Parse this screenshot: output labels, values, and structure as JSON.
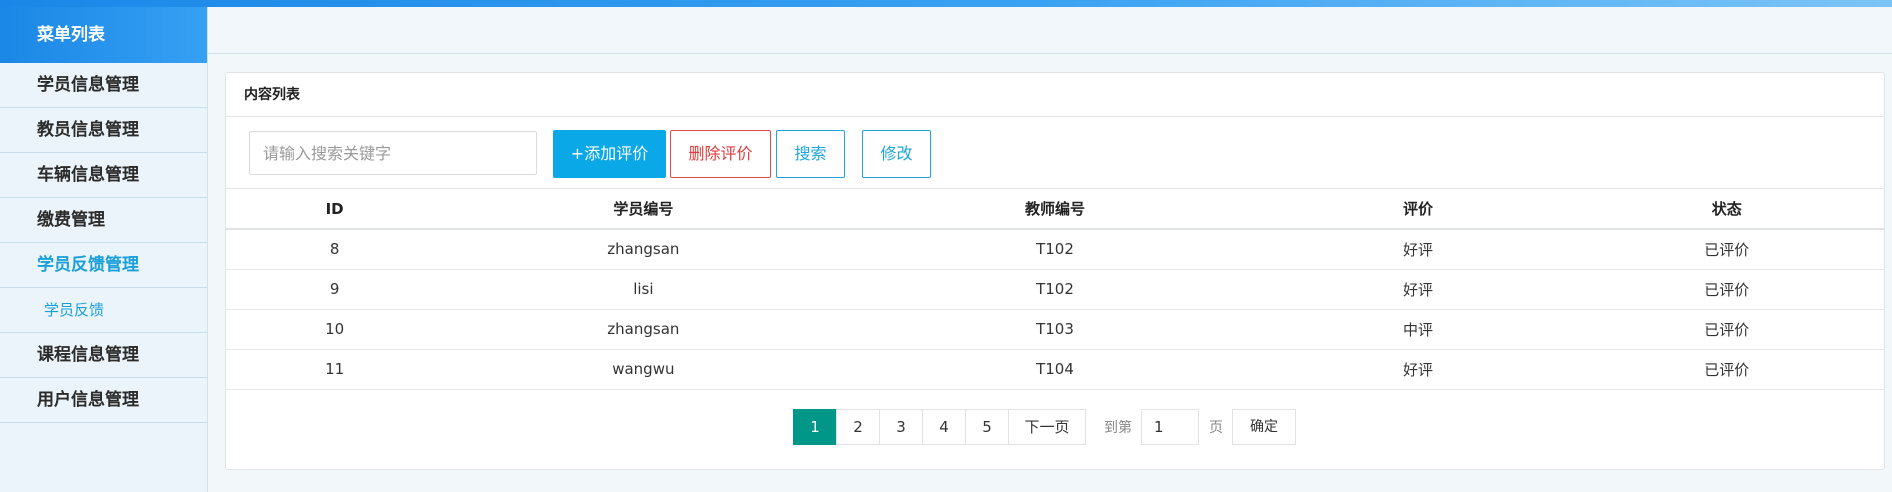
{
  "sidebar": {
    "title": "菜单列表",
    "items": [
      {
        "label": "学员信息管理"
      },
      {
        "label": "教员信息管理"
      },
      {
        "label": "车辆信息管理"
      },
      {
        "label": "缴费管理"
      },
      {
        "label": "学员反馈管理",
        "active": true
      },
      {
        "label": "学员反馈",
        "sub": true
      },
      {
        "label": "课程信息管理"
      },
      {
        "label": "用户信息管理"
      }
    ]
  },
  "panel": {
    "title": "内容列表"
  },
  "toolbar": {
    "search_placeholder": "请输入搜索关键字",
    "add_label": "+添加评价",
    "delete_label": "删除评价",
    "search_label": "搜索",
    "edit_label": "修改"
  },
  "table": {
    "columns": [
      "ID",
      "学员编号",
      "教师编号",
      "评价",
      "状态"
    ],
    "rows": [
      [
        "8",
        "zhangsan",
        "T102",
        "好评",
        "已评价"
      ],
      [
        "9",
        "lisi",
        "T102",
        "好评",
        "已评价"
      ],
      [
        "10",
        "zhangsan",
        "T103",
        "中评",
        "已评价"
      ],
      [
        "11",
        "wangwu",
        "T104",
        "好评",
        "已评价"
      ]
    ]
  },
  "pagination": {
    "pages": [
      "1",
      "2",
      "3",
      "4",
      "5"
    ],
    "current": "1",
    "next_label": "下一页",
    "goto_label": "到第",
    "goto_value": "1",
    "page_unit": "页",
    "confirm_label": "确定"
  },
  "colors": {
    "accent": "#0aa8e6",
    "danger": "#e03a3a",
    "page_current": "#009688",
    "menu_active": "#1a9fd8"
  }
}
